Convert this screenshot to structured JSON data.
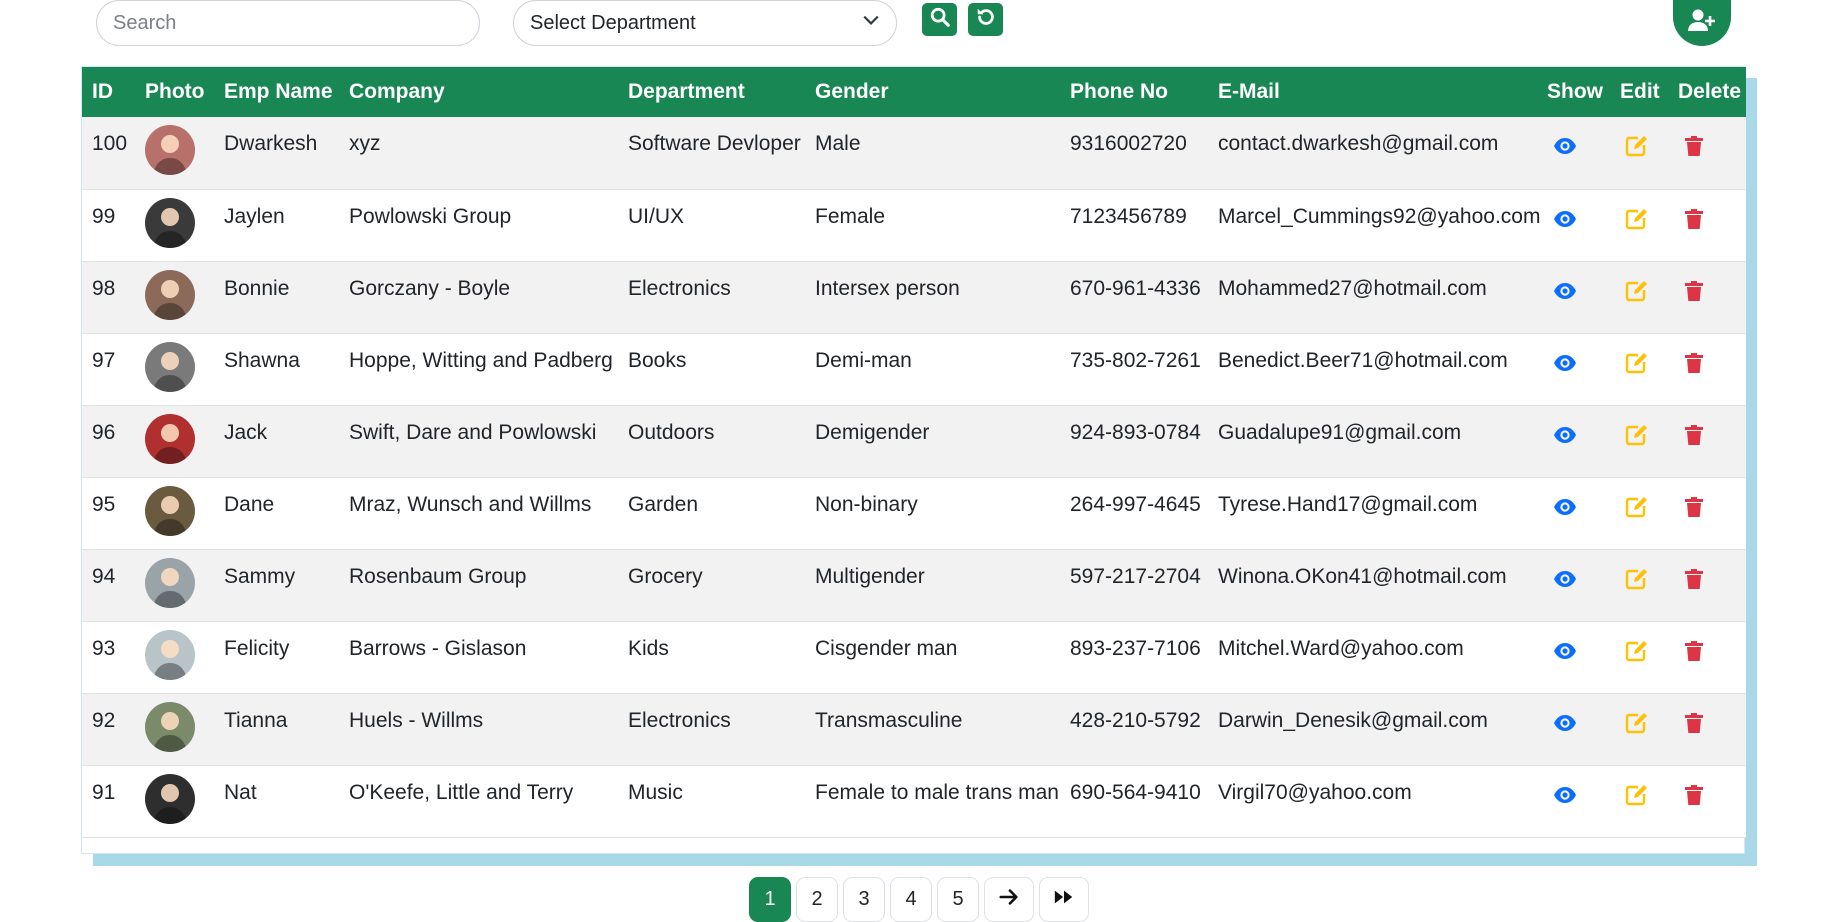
{
  "toolbar": {
    "search_placeholder": "Search",
    "search_value": "",
    "department_select": "Select Department",
    "search_button_icon": "search-icon",
    "reset_button_icon": "refresh-icon",
    "add_user_icon": "user-plus-icon"
  },
  "colors": {
    "primary": "#198754",
    "show_icon": "#0d6efd",
    "edit_icon": "#ffc107",
    "delete_icon": "#dc3545",
    "shadow": "#a9d8e8"
  },
  "table": {
    "columns": [
      "ID",
      "Photo",
      "Emp Name",
      "Company",
      "Department",
      "Gender",
      "Phone No",
      "E-Mail",
      "Show",
      "Edit",
      "Delete"
    ],
    "rows": [
      {
        "id": "100",
        "name": "Dwarkesh",
        "company": "xyz",
        "department": "Software Devloper",
        "gender": "Male",
        "phone": "9316002720",
        "email": "contact.dwarkesh@gmail.com",
        "avatar_color": "#b8706a"
      },
      {
        "id": "99",
        "name": "Jaylen",
        "company": "Powlowski Group",
        "department": "UI/UX",
        "gender": "Female",
        "phone": "7123456789",
        "email": "Marcel_Cummings92@yahoo.com",
        "avatar_color": "#3a3a3a"
      },
      {
        "id": "98",
        "name": "Bonnie",
        "company": "Gorczany - Boyle",
        "department": "Electronics",
        "gender": "Intersex person",
        "phone": "670-961-4336",
        "email": "Mohammed27@hotmail.com",
        "avatar_color": "#8b6a5a"
      },
      {
        "id": "97",
        "name": "Shawna",
        "company": "Hoppe, Witting and Padberg",
        "department": "Books",
        "gender": "Demi-man",
        "phone": "735-802-7261",
        "email": "Benedict.Beer71@hotmail.com",
        "avatar_color": "#7a7a7a"
      },
      {
        "id": "96",
        "name": "Jack",
        "company": "Swift, Dare and Powlowski",
        "department": "Outdoors",
        "gender": "Demigender",
        "phone": "924-893-0784",
        "email": "Guadalupe91@gmail.com",
        "avatar_color": "#b03030"
      },
      {
        "id": "95",
        "name": "Dane",
        "company": "Mraz, Wunsch and Willms",
        "department": "Garden",
        "gender": "Non-binary",
        "phone": "264-997-4645",
        "email": "Tyrese.Hand17@gmail.com",
        "avatar_color": "#6a5a40"
      },
      {
        "id": "94",
        "name": "Sammy",
        "company": "Rosenbaum Group",
        "department": "Grocery",
        "gender": "Multigender",
        "phone": "597-217-2704",
        "email": "Winona.OKon41@hotmail.com",
        "avatar_color": "#9aa3a8"
      },
      {
        "id": "93",
        "name": "Felicity",
        "company": "Barrows - Gislason",
        "department": "Kids",
        "gender": "Cisgender man",
        "phone": "893-237-7106",
        "email": "Mitchel.Ward@yahoo.com",
        "avatar_color": "#b8c4c8"
      },
      {
        "id": "92",
        "name": "Tianna",
        "company": "Huels - Willms",
        "department": "Electronics",
        "gender": "Transmasculine",
        "phone": "428-210-5792",
        "email": "Darwin_Denesik@gmail.com",
        "avatar_color": "#7a8a6a"
      },
      {
        "id": "91",
        "name": "Nat",
        "company": "O'Keefe, Little and Terry",
        "department": "Music",
        "gender": "Female to male trans man",
        "phone": "690-564-9410",
        "email": "Virgil70@yahoo.com",
        "avatar_color": "#2e2e2e"
      }
    ],
    "action_icons": {
      "show": "eye-icon",
      "edit": "edit-icon",
      "delete": "trash-icon"
    }
  },
  "pagination": {
    "pages": [
      "1",
      "2",
      "3",
      "4",
      "5"
    ],
    "current": "1",
    "next_icon": "arrow-right-icon",
    "last_icon": "fast-forward-icon"
  }
}
